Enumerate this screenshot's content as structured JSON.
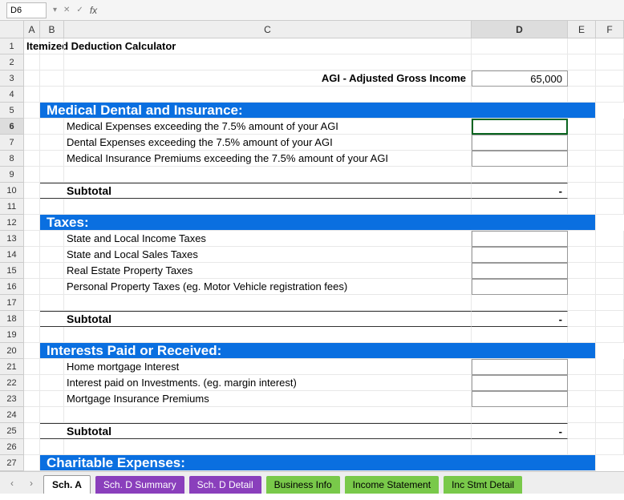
{
  "toolbar": {
    "namebox": "D6",
    "fx_label": "fx"
  },
  "columns": [
    "A",
    "B",
    "C",
    "D",
    "E",
    "F"
  ],
  "row_numbers": [
    1,
    2,
    3,
    4,
    5,
    6,
    7,
    8,
    9,
    10,
    11,
    12,
    13,
    14,
    15,
    16,
    17,
    18,
    19,
    20,
    21,
    22,
    23,
    24,
    25,
    26,
    27
  ],
  "title": "Itemized Deduction Calculator",
  "agi": {
    "label": "AGI - Adjusted Gross Income",
    "value": "65,000"
  },
  "sections": {
    "medical": {
      "header": "Medical Dental and Insurance:",
      "items": [
        "Medical Expenses exceeding the 7.5% amount of your AGI",
        "Dental Expenses exceeding the 7.5% amount of your AGI",
        "Medical Insurance Premiums exceeding the 7.5% amount of your AGI"
      ],
      "subtotal_label": "Subtotal",
      "subtotal_value": "-"
    },
    "taxes": {
      "header": "Taxes:",
      "items": [
        "State and Local Income Taxes",
        "State and Local Sales Taxes",
        "Real Estate Property Taxes",
        "Personal Property Taxes (eg. Motor Vehicle registration fees)"
      ],
      "subtotal_label": "Subtotal",
      "subtotal_value": "-"
    },
    "interests": {
      "header": "Interests Paid or Received:",
      "items": [
        "Home mortgage Interest",
        "Interest paid on Investments. (eg. margin interest)",
        "Mortgage Insurance Premiums"
      ],
      "subtotal_label": "Subtotal",
      "subtotal_value": "-"
    },
    "charitable": {
      "header": "Charitable Expenses:"
    }
  },
  "tabs": [
    {
      "label": "Sch. A",
      "style": "active"
    },
    {
      "label": "Sch. D Summary",
      "style": "purple"
    },
    {
      "label": "Sch. D Detail",
      "style": "purple"
    },
    {
      "label": "Business Info",
      "style": "green"
    },
    {
      "label": "Income Statement",
      "style": "green"
    },
    {
      "label": "Inc Stmt Detail",
      "style": "green"
    }
  ],
  "active_cell": "D6",
  "active_col": "D",
  "active_row": 6
}
